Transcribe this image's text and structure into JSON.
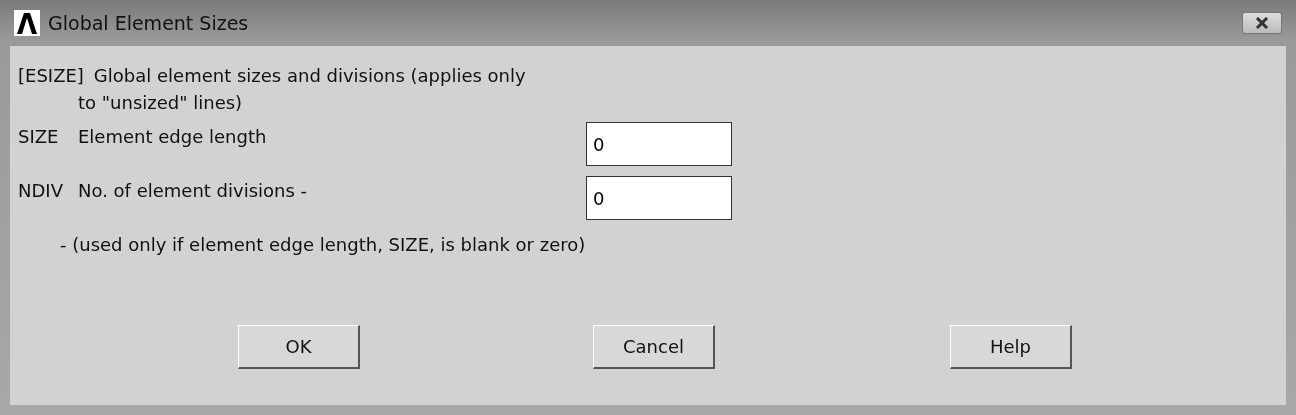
{
  "window": {
    "title": "Global Element Sizes"
  },
  "heading": {
    "command": "[ESIZE]",
    "text": "Global element sizes and divisions (applies only",
    "continuation": "to \"unsized\" lines)"
  },
  "fields": [
    {
      "code": "SIZE",
      "label": "Element edge length",
      "value": "0"
    },
    {
      "code": "NDIV",
      "label": "No. of element divisions -",
      "value": "0"
    }
  ],
  "note": "- (used only if element edge length, SIZE, is blank or zero)",
  "buttons": [
    "OK",
    "Cancel",
    "Help"
  ]
}
